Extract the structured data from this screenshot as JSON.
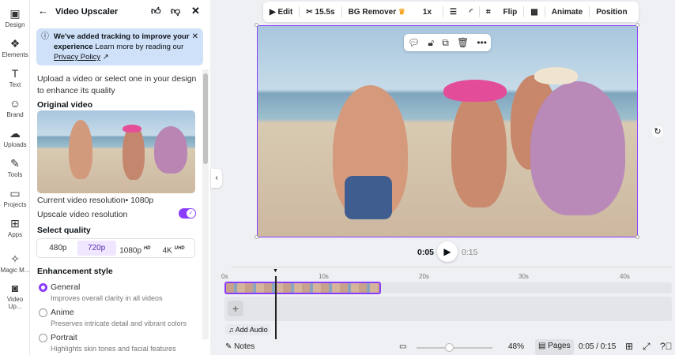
{
  "rail": [
    {
      "label": "Design",
      "icon": "▣"
    },
    {
      "label": "Elements",
      "icon": "❖"
    },
    {
      "label": "Text",
      "icon": "T"
    },
    {
      "label": "Brand",
      "icon": "☺"
    },
    {
      "label": "Uploads",
      "icon": "☁"
    },
    {
      "label": "Tools",
      "icon": "✎"
    },
    {
      "label": "Projects",
      "icon": "▭"
    },
    {
      "label": "Apps",
      "icon": "⊞"
    },
    {
      "label": "Magic M...",
      "icon": "✧"
    },
    {
      "label": "Video Up...",
      "icon": "◙"
    }
  ],
  "panel": {
    "title": "Video Upscaler",
    "notice_bold": "We've added tracking to improve your experience",
    "notice_rest": " Learn more by reading our ",
    "notice_link": "Privacy Policy",
    "intro": "Upload a video or select one in your design to enhance its quality",
    "original_heading": "Original video",
    "current_res": "Current video resolution• 1080p",
    "upscale_label": "Upscale video resolution",
    "upscale_on": true,
    "quality_heading": "Select quality",
    "quality": [
      {
        "label": "480p",
        "tag": ""
      },
      {
        "label": "720p",
        "tag": "",
        "selected": true
      },
      {
        "label": "1080p",
        "tag": "HD"
      },
      {
        "label": "4K",
        "tag": "UHD"
      }
    ],
    "style_heading": "Enhancement style",
    "styles": [
      {
        "label": "General",
        "desc": "Improves overall clarity in all videos",
        "selected": true
      },
      {
        "label": "Anime",
        "desc": "Preserves intricate detail and vibrant colors"
      },
      {
        "label": "Portrait",
        "desc": "Highlights skin tones and facial features"
      }
    ]
  },
  "toolbar": {
    "edit": "Edit",
    "duration": "15.5s",
    "bg_remover": "BG Remover",
    "speed": "1x",
    "flip": "Flip",
    "animate": "Animate",
    "position": "Position"
  },
  "playback": {
    "current": "0:05",
    "total": "0:15"
  },
  "timeline": {
    "ticks": [
      "0s",
      "10s",
      "20s",
      "30s",
      "40s"
    ],
    "add_audio": "Add Audio"
  },
  "bottom": {
    "notes": "Notes",
    "zoom": "48%",
    "zoom_fraction": 0.3,
    "pages": "Pages",
    "time": "0:05 / 0:15"
  },
  "colors": {
    "accent": "#8b3dff"
  }
}
